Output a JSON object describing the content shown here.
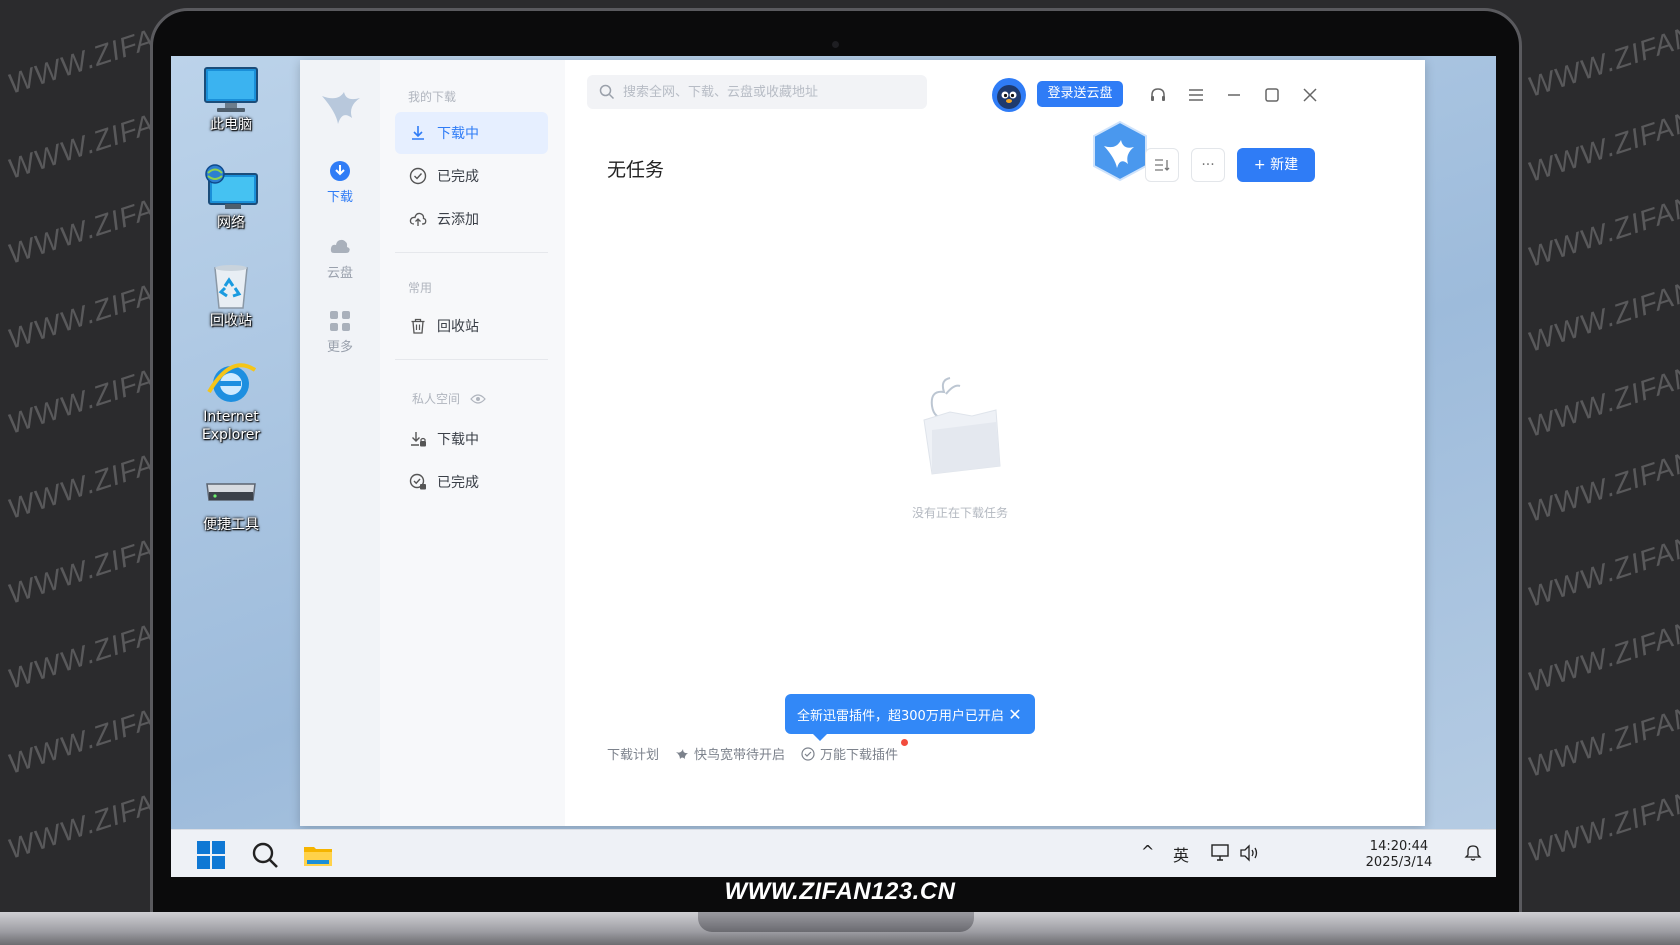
{
  "watermark": "WWW.ZIFAN123.CN",
  "watermark_left_partial": "WWW.ZIFAN1",
  "brand_text": "WWW.ZIFAN123.CN",
  "desktop": {
    "icons": [
      {
        "label": "此电脑"
      },
      {
        "label": "网络"
      },
      {
        "label": "回收站"
      },
      {
        "label": "Internet Explorer"
      },
      {
        "label": "便捷工具"
      }
    ]
  },
  "app": {
    "rail": {
      "items": [
        {
          "label": "下载",
          "icon": "download-icon",
          "active": true
        },
        {
          "label": "云盘",
          "icon": "cloud-icon"
        },
        {
          "label": "更多",
          "icon": "grid-icon"
        }
      ]
    },
    "nav": {
      "section_my_downloads": "我的下载",
      "downloading": "下载中",
      "completed": "已完成",
      "cloud_add": "云添加",
      "section_common": "常用",
      "recycle": "回收站",
      "section_private": "私人空间",
      "private_downloading": "下载中",
      "private_completed": "已完成"
    },
    "search_placeholder": "搜索全网、下载、云盘或收藏地址",
    "login_button": "登录送云盘",
    "title": "无任务",
    "new_button": "+ 新建",
    "more_button": "···",
    "empty_text": "没有正在下载任务",
    "toast": {
      "text": "全新迅雷插件，超300万用户已开启",
      "close": "✕"
    },
    "footer": {
      "plan": "下载计划",
      "speed": "快鸟宽带待开启",
      "plugin": "万能下载插件"
    },
    "colors": {
      "accent": "#2f7cf6",
      "badge": "#f24c3d"
    }
  },
  "taskbar": {
    "tray_ime": "英",
    "tray_chevron": "^",
    "time": "14:20:44",
    "date": "2025/3/14"
  }
}
